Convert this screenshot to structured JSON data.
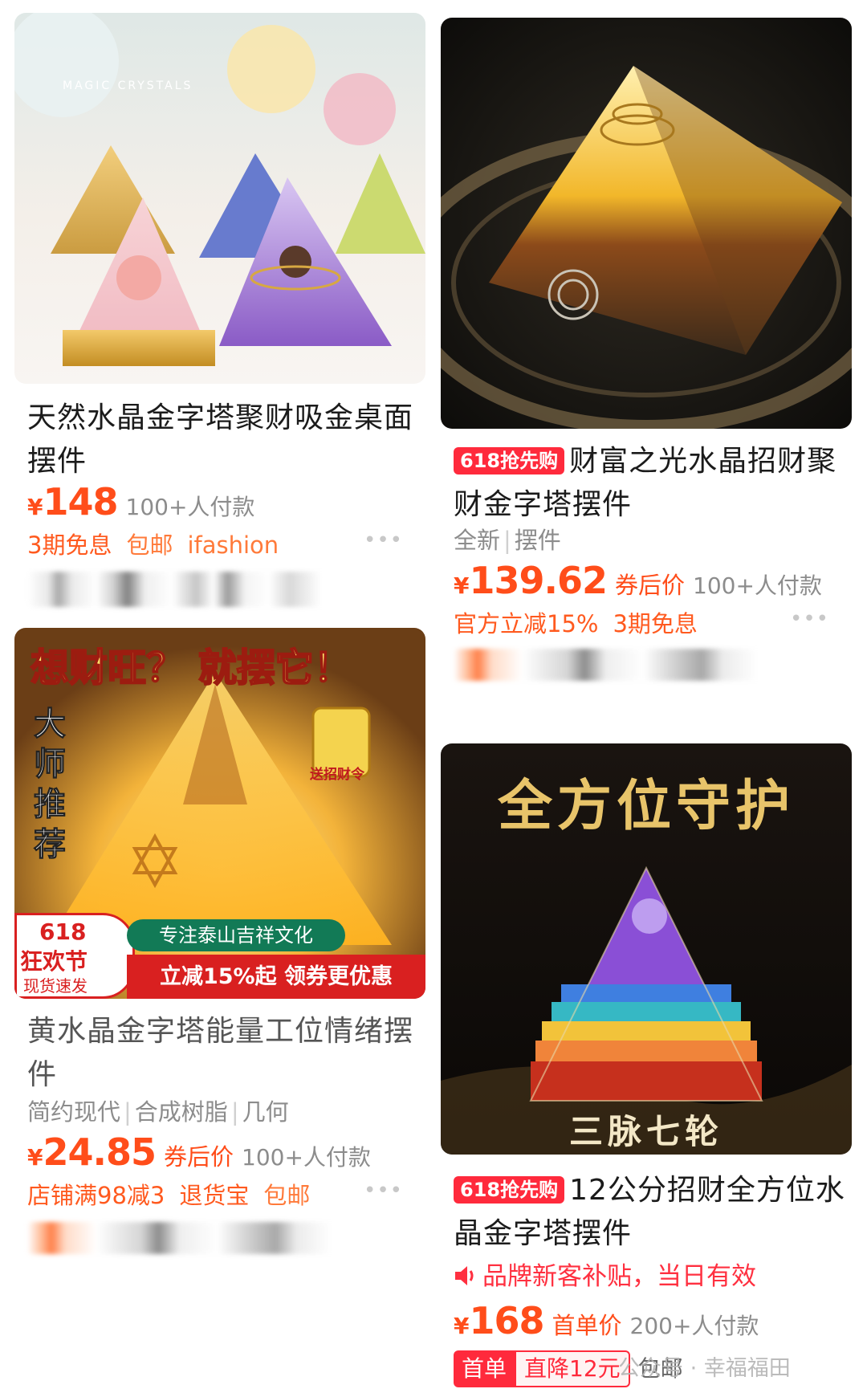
{
  "products": [
    {
      "image_label": "MAGIC CRYSTALS",
      "title": "天然水晶金字塔聚财吸金桌面摆件",
      "currency": "¥",
      "price": "148",
      "sold": "100+人付款",
      "benefits": [
        "3期免息",
        "包邮",
        "ifashion"
      ],
      "more": "•••"
    },
    {
      "promo": "618抢先购",
      "title": "财富之光水晶招财聚财金字塔摆件",
      "tags": [
        "全新",
        "摆件"
      ],
      "currency": "¥",
      "price": "139.62",
      "price_note": "券后价",
      "sold": "100+人付款",
      "benefits": [
        "官方立减15%",
        "3期免息"
      ],
      "more": "•••"
    },
    {
      "image_text": {
        "headline": "想财旺？ 就摆它！",
        "side": "大师推荐",
        "amulet": "送招财令",
        "badge_618": "618",
        "badge_festival": "狂欢节",
        "badge_ship": "现货速发",
        "banner_top": "专注泰山吉祥文化",
        "banner_bottom": "立减15%起 领券更优惠"
      },
      "title": "黄水晶金字塔能量工位情绪摆件",
      "tags": [
        "简约现代",
        "合成树脂",
        "几何"
      ],
      "currency": "¥",
      "price": "24.85",
      "price_note": "券后价",
      "sold": "100+人付款",
      "benefits": [
        "店铺满98减3",
        "退货宝",
        "包邮"
      ],
      "more": "•••"
    },
    {
      "image_text": {
        "headline": "全方位守护",
        "footer": "三脉七轮"
      },
      "promo": "618抢先购",
      "title": "12公分招财全方位水晶金字塔摆件",
      "notice": "品牌新客补贴，当日有效",
      "currency": "¥",
      "price": "168",
      "price_note": "首单价",
      "sold": "200+人付款",
      "first_order_tag": "首单",
      "first_order_value": "直降12元",
      "free_shipping": "包邮"
    }
  ],
  "watermark": "公众号 · 幸福福田",
  "colors": {
    "price": "#ff4d1a",
    "promo_red": "#ff2a3c",
    "muted": "#8c8c8c"
  }
}
